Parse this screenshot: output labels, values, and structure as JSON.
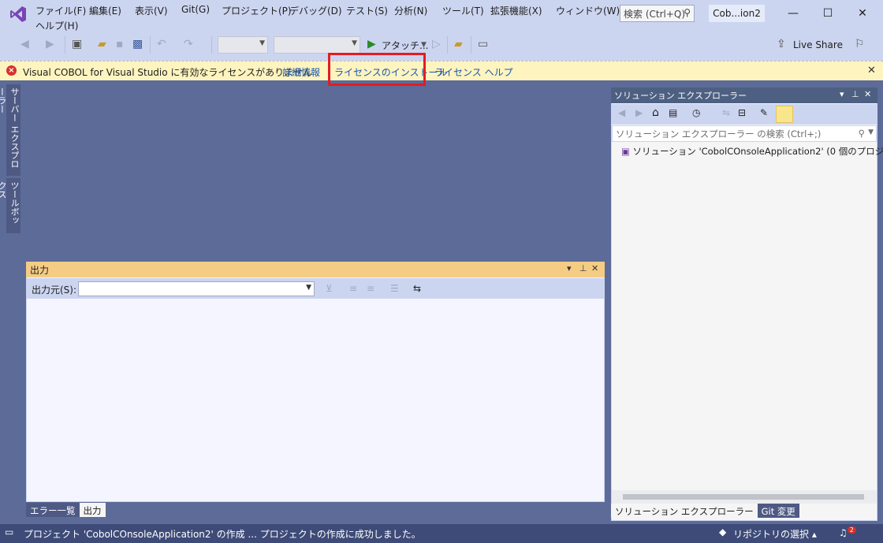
{
  "menu": {
    "items": [
      "ファイル(F)",
      "編集(E)",
      "表示(V)",
      "Git(G)",
      "プロジェクト(P)",
      "デバッグ(D)",
      "テスト(S)",
      "分析(N)",
      "ツール(T)",
      "拡張機能(X)",
      "ウィンドウ(W)",
      "ヘルプ(H)"
    ]
  },
  "title": {
    "search_placeholder": "検索 (Ctrl+Q)",
    "solution_name": "Cob...ion2"
  },
  "toolbar": {
    "attach_label": "アタッチ...",
    "live_share_label": "Live Share"
  },
  "infobar": {
    "message": "Visual COBOL for Visual Studio に有効なライセンスがありません",
    "link_details": "詳細情報",
    "link_install": "ライセンスのインストール",
    "link_help": "ライセンス ヘルプ"
  },
  "side_tabs": {
    "server_explorer": "サーバー エクスプローラー",
    "toolbox": "ツールボックス"
  },
  "solution_explorer": {
    "title": "ソリューション エクスプローラー",
    "search_placeholder": "ソリューション エクスプローラー の検索 (Ctrl+;)",
    "item": "ソリューション 'CobolCOnsoleApplication2' (0 個のプロジェクト)",
    "tabs": [
      "ソリューション エクスプローラー",
      "Git 変更"
    ]
  },
  "output": {
    "title": "出力",
    "source_label": "出力元(S):",
    "source_value": "",
    "tabs": [
      "エラー一覧",
      "出力"
    ]
  },
  "statusbar": {
    "message": "プロジェクト 'CobolCOnsoleApplication2' の作成 ... プロジェクトの作成に成功しました。",
    "repo_label": "リポジトリの選択",
    "notification_count": "2"
  },
  "colors": {
    "accent": "#5d6b99",
    "highlight": "#e31c23",
    "infobar": "#fdf4bf",
    "output_header": "#f5cc84"
  }
}
